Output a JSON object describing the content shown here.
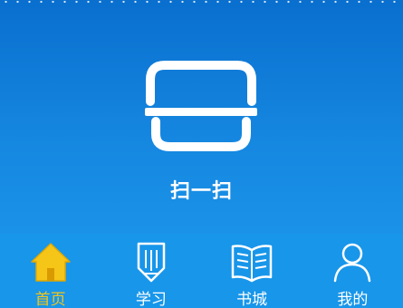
{
  "scan": {
    "label": "扫一扫"
  },
  "tabs": [
    {
      "label": "首页",
      "icon": "home-icon",
      "active": true
    },
    {
      "label": "学习",
      "icon": "pencil-icon",
      "active": false
    },
    {
      "label": "书城",
      "icon": "book-icon",
      "active": false
    },
    {
      "label": "我的",
      "icon": "user-icon",
      "active": false
    }
  ],
  "colors": {
    "background_top": "#0a6fcf",
    "background_bottom": "#1f9bee",
    "tabbar": "#1896ea",
    "active": "#f5c518",
    "inactive": "#ffffff"
  }
}
